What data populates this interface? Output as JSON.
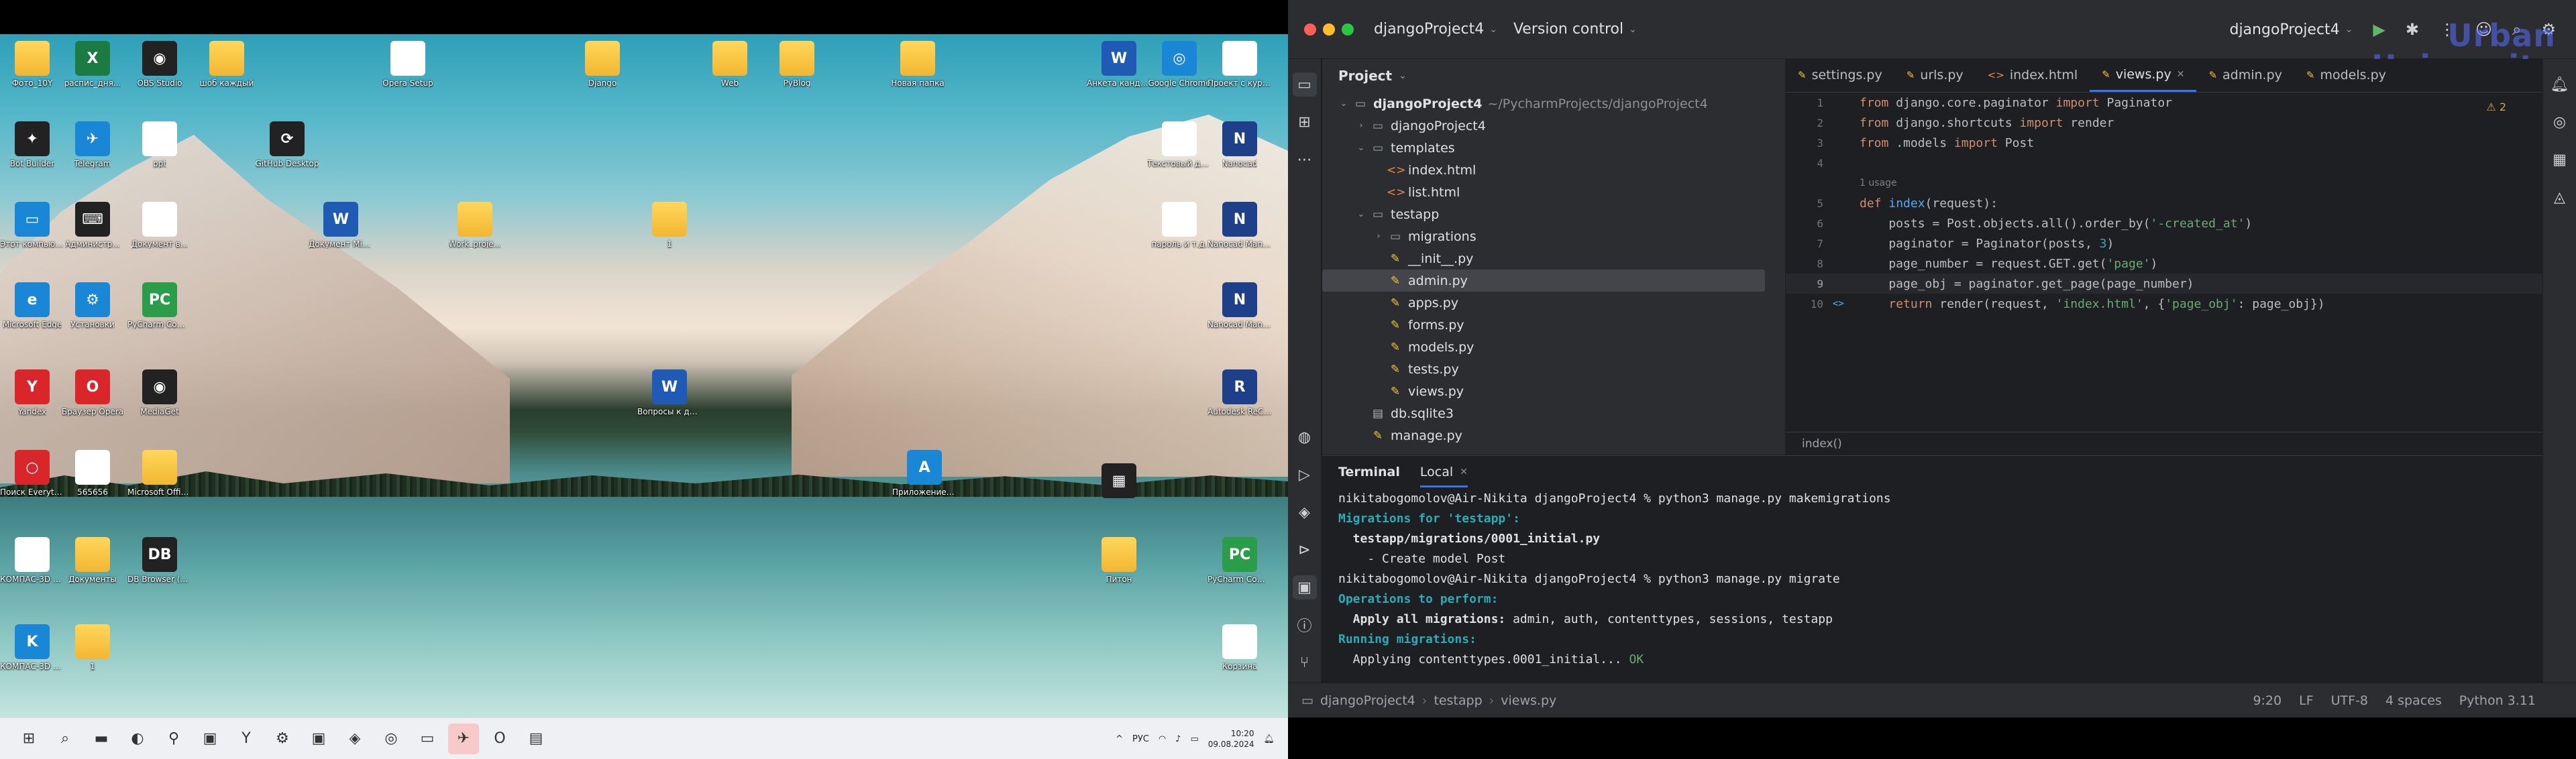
{
  "desktop": {
    "icons": [
      {
        "label": "Фото_10Y",
        "glyph": "",
        "kind": "folder"
      },
      {
        "label": "распис_дня...",
        "glyph": "X",
        "kind": "excel"
      },
      {
        "label": "OBS Studio",
        "glyph": "◉",
        "kind": "dark"
      },
      {
        "label": "шоб каждый",
        "glyph": "",
        "kind": "folder"
      },
      {
        "label": "Opera Setup",
        "glyph": "⇩",
        "kind": "doc"
      },
      {
        "label": "Django",
        "glyph": "",
        "kind": "folder"
      },
      {
        "label": "Web",
        "glyph": "",
        "kind": "folder"
      },
      {
        "label": "PyBlog",
        "glyph": "",
        "kind": "folder"
      },
      {
        "label": "Новая папка",
        "glyph": "",
        "kind": "folder"
      },
      {
        "label": "Анкета кандидата",
        "glyph": "W",
        "kind": "word"
      },
      {
        "label": "Google Chrome",
        "glyph": "◎",
        "kind": "blue"
      },
      {
        "label": "Проект с курсами",
        "glyph": "",
        "kind": "doc"
      },
      {
        "label": "Bot Builder",
        "glyph": "✦",
        "kind": "dark"
      },
      {
        "label": "Telegram",
        "glyph": "✈",
        "kind": "blue"
      },
      {
        "label": "ppt",
        "glyph": "",
        "kind": "doc"
      },
      {
        "label": "GitHub Desktop",
        "glyph": "⟳",
        "kind": "dark"
      },
      {
        "label": "Текстовый документ",
        "glyph": "",
        "kind": "doc"
      },
      {
        "label": "Nanocad",
        "glyph": "N",
        "kind": "nano"
      },
      {
        "label": "Этот компьютер",
        "glyph": "▭",
        "kind": "blue"
      },
      {
        "label": "Администр...",
        "glyph": "⌨",
        "kind": "dark"
      },
      {
        "label": "Документ в...",
        "glyph": "",
        "kind": "doc"
      },
      {
        "label": "Документ Microsoft",
        "glyph": "W",
        "kind": "word"
      },
      {
        "label": "Work_proje...",
        "glyph": "",
        "kind": "folder"
      },
      {
        "label": "1",
        "glyph": "",
        "kind": "folder"
      },
      {
        "label": "пароль и т.д.",
        "glyph": "",
        "kind": "doc"
      },
      {
        "label": "Nanocad Manager 2024",
        "glyph": "N",
        "kind": "nano"
      },
      {
        "label": "Microsoft Edge",
        "glyph": "e",
        "kind": "blue"
      },
      {
        "label": "Установки",
        "glyph": "⚙",
        "kind": "blue"
      },
      {
        "label": "PyCharm Comm...",
        "glyph": "PC",
        "kind": "green"
      },
      {
        "label": "Nanocad Manager Pl...",
        "glyph": "N",
        "kind": "nano"
      },
      {
        "label": "Yandex",
        "glyph": "Y",
        "kind": "red"
      },
      {
        "label": "Браузер Opera",
        "glyph": "O",
        "kind": "red"
      },
      {
        "label": "MediaGet",
        "glyph": "◉",
        "kind": "dark"
      },
      {
        "label": "Вопросы к диплому",
        "glyph": "W",
        "kind": "word"
      },
      {
        "label": "Autodesk ReCap",
        "glyph": "R",
        "kind": "nano"
      },
      {
        "label": "Поиск Everything",
        "glyph": "○",
        "kind": "red"
      },
      {
        "label": "565656",
        "glyph": "",
        "kind": "doc"
      },
      {
        "label": "Microsoft Office 2016",
        "glyph": "",
        "kind": "folder"
      },
      {
        "label": "Приложение Autodesk ..",
        "glyph": "A",
        "kind": "blue"
      },
      {
        "label": "",
        "glyph": "▦",
        "kind": "dark"
      },
      {
        "label": "КОМПАС-3D v21 x64",
        "glyph": "",
        "kind": "doc"
      },
      {
        "label": "Документы",
        "glyph": "",
        "kind": "folder"
      },
      {
        "label": "DB Browser (SQLCipher)",
        "glyph": "DB",
        "kind": "dark"
      },
      {
        "label": "Питон",
        "glyph": "",
        "kind": "folder"
      },
      {
        "label": "PyCharm Commu...",
        "glyph": "PC",
        "kind": "green"
      },
      {
        "label": "КОМПАС-3D v19",
        "glyph": "K",
        "kind": "blue"
      },
      {
        "label": "1",
        "glyph": "",
        "kind": "folder"
      },
      {
        "label": "Корзина",
        "glyph": "♻",
        "kind": "doc"
      }
    ]
  },
  "taskbar": {
    "apps": [
      "windows-start",
      "search",
      "file-explorer",
      "edge",
      "search-app",
      "remote-desktop",
      "yandex",
      "settings",
      "pycharm",
      "app-blue",
      "chrome",
      "terminal",
      "telegram",
      "opera",
      "calculator"
    ],
    "app_glyphs": [
      "⊞",
      "⌕",
      "▬",
      "◐",
      "⚲",
      "▣",
      "Y",
      "⚙",
      "▣",
      "◈",
      "◎",
      "▭",
      "✈",
      "O",
      "▤"
    ],
    "tray": {
      "lang": "РУС",
      "time": "10:20",
      "date": "09.08.2024"
    }
  },
  "ide": {
    "project_name": "djangoProject4",
    "vcs": "Version control",
    "run_config": "djangoProject4",
    "watermark_line1": "Urban",
    "watermark_line2": "University",
    "project_panel_title": "Project",
    "tree": [
      {
        "label": "djangoProject4",
        "path": "~/PycharmProjects/djangoProject4",
        "indent": 0,
        "arrow": "⌄",
        "icon": "▭",
        "type": "folder",
        "bold": true
      },
      {
        "label": "djangoProject4",
        "indent": 1,
        "arrow": "›",
        "icon": "▭",
        "type": "folder"
      },
      {
        "label": "templates",
        "indent": 1,
        "arrow": "⌄",
        "icon": "▭",
        "type": "folder"
      },
      {
        "label": "index.html",
        "indent": 2,
        "arrow": "",
        "icon": "<>",
        "type": "html"
      },
      {
        "label": "list.html",
        "indent": 2,
        "arrow": "",
        "icon": "<>",
        "type": "html"
      },
      {
        "label": "testapp",
        "indent": 1,
        "arrow": "⌄",
        "icon": "▭",
        "type": "folder"
      },
      {
        "label": "migrations",
        "indent": 2,
        "arrow": "›",
        "icon": "▭",
        "type": "folder"
      },
      {
        "label": "__init__.py",
        "indent": 2,
        "arrow": "",
        "icon": "✎",
        "type": "py"
      },
      {
        "label": "admin.py",
        "indent": 2,
        "arrow": "",
        "icon": "✎",
        "type": "py",
        "selected": true
      },
      {
        "label": "apps.py",
        "indent": 2,
        "arrow": "",
        "icon": "✎",
        "type": "py"
      },
      {
        "label": "forms.py",
        "indent": 2,
        "arrow": "",
        "icon": "✎",
        "type": "py"
      },
      {
        "label": "models.py",
        "indent": 2,
        "arrow": "",
        "icon": "✎",
        "type": "py"
      },
      {
        "label": "tests.py",
        "indent": 2,
        "arrow": "",
        "icon": "✎",
        "type": "py"
      },
      {
        "label": "views.py",
        "indent": 2,
        "arrow": "",
        "icon": "✎",
        "type": "py"
      },
      {
        "label": "db.sqlite3",
        "indent": 1,
        "arrow": "",
        "icon": "▤",
        "type": "db"
      },
      {
        "label": "manage.py",
        "indent": 1,
        "arrow": "",
        "icon": "✎",
        "type": "py"
      }
    ],
    "tabs": [
      {
        "label": "settings.py",
        "icon": "✎",
        "type": "py"
      },
      {
        "label": "urls.py",
        "icon": "✎",
        "type": "py"
      },
      {
        "label": "index.html",
        "icon": "<>",
        "type": "html"
      },
      {
        "label": "views.py",
        "icon": "✎",
        "type": "py",
        "active": true
      },
      {
        "label": "admin.py",
        "icon": "✎",
        "type": "py"
      },
      {
        "label": "models.py",
        "icon": "✎",
        "type": "py"
      }
    ],
    "warnings": "⚠ 2",
    "usage_hint": "1 usage",
    "code_breadcrumb": "index()",
    "terminal_title": "Terminal",
    "terminal_tab": "Local",
    "status": {
      "path": [
        "djangoProject4",
        "testapp",
        "views.py"
      ],
      "position": "9:20",
      "line_ending": "LF",
      "encoding": "UTF-8",
      "indent": "4 spaces",
      "interpreter": "Python 3.11"
    }
  }
}
